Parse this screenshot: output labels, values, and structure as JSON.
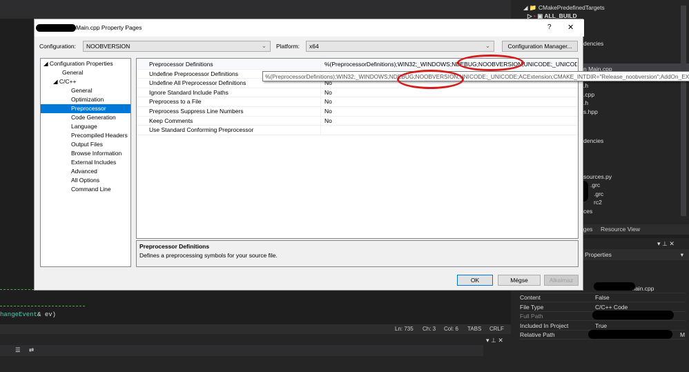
{
  "dialog": {
    "title": "Main.cpp Property Pages",
    "help": "?",
    "close": "✕",
    "configuration_label": "Configuration:",
    "configuration_value": "NOOBVERSION",
    "platform_label": "Platform:",
    "platform_value": "x64",
    "config_manager": "Configuration Manager...",
    "tree": [
      "Configuration Properties",
      "General",
      "C/C++",
      "General",
      "Optimization",
      "Preprocessor",
      "Code Generation",
      "Language",
      "Precompiled Headers",
      "Output Files",
      "Browse Information",
      "External Includes",
      "Advanced",
      "All Options",
      "Command Line"
    ],
    "rows": [
      {
        "name": "Preprocessor Definitions",
        "value": "%(PreprocessorDefinitions);WIN32;_WINDOWS;NDEBUG;NOOBVERSION;UNICODE;_UNICODE;AC"
      },
      {
        "name": "Undefine Preprocessor Definitions",
        "value": ""
      },
      {
        "name": "Undefine All Preprocessor Definitions",
        "value": "No"
      },
      {
        "name": "Ignore Standard Include Paths",
        "value": "No"
      },
      {
        "name": "Preprocess to a File",
        "value": "No"
      },
      {
        "name": "Preprocess Suppress Line Numbers",
        "value": "No"
      },
      {
        "name": "Keep Comments",
        "value": "No"
      },
      {
        "name": "Use Standard Conforming Preprocessor",
        "value": ""
      }
    ],
    "tooltip": "%(PreprocessorDefinitions);WIN32;_WINDOWS;NDEBUG;NOOBVERSION;UNICODE;_UNICODE;ACExtension;CMAKE_INTDIR=\"Release_noobversion\";AddOn_EXPORTS",
    "desc_title": "Preprocessor Definitions",
    "desc_text": "Defines a preprocessing symbols for your source file.",
    "ok": "OK",
    "cancel": "Mégse",
    "apply": "Alkalmaz"
  },
  "ide": {
    "code": "hangeEvent",
    "code_rest": "& ev)",
    "status": {
      "ln": "Ln: 735",
      "ch": "Ch: 3",
      "col": "Col: 6",
      "tabs": "TABS",
      "crlf": "CRLF"
    },
    "solution_items": [
      "CMakePredefinedTargets",
      "ALL_BUILD",
      "dencies",
      "n Main.cpp",
      ".h",
      ".cpp",
      ".h",
      "s.hpp",
      "dencies",
      "sources.py",
      ".grc",
      ".grc",
      "rc2",
      "ces"
    ],
    "tabs": [
      "nges",
      "Resource View"
    ],
    "props_title": "e Properties",
    "props": [
      {
        "l": "",
        "v": "Main.cpp"
      },
      {
        "l": "Content",
        "v": "False"
      },
      {
        "l": "File Type",
        "v": "C/C++ Code"
      },
      {
        "l": "Full Path",
        "v": ""
      },
      {
        "l": "Included In Project",
        "v": "True"
      },
      {
        "l": "Relative Path",
        "v": "M"
      }
    ]
  },
  "colors": {
    "accent": "#0078d7",
    "highlight": "#d31d1d"
  }
}
